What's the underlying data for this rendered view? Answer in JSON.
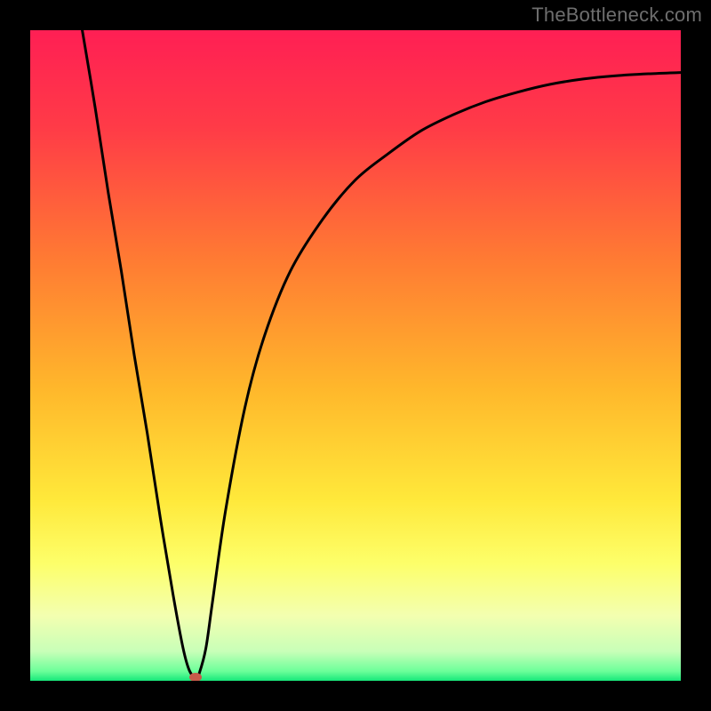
{
  "watermark": "TheBottleneck.com",
  "chart_data": {
    "type": "line",
    "title": "",
    "xlabel": "",
    "ylabel": "",
    "xlim": [
      0,
      100
    ],
    "ylim": [
      0,
      100
    ],
    "grid": false,
    "gradient_stops": [
      {
        "offset": 0.0,
        "color": "#ff1f54"
      },
      {
        "offset": 0.15,
        "color": "#ff3b47"
      },
      {
        "offset": 0.35,
        "color": "#ff7a33"
      },
      {
        "offset": 0.55,
        "color": "#ffb72b"
      },
      {
        "offset": 0.72,
        "color": "#ffe83a"
      },
      {
        "offset": 0.82,
        "color": "#fdff6a"
      },
      {
        "offset": 0.9,
        "color": "#f3ffb0"
      },
      {
        "offset": 0.955,
        "color": "#c8ffb8"
      },
      {
        "offset": 0.985,
        "color": "#6dff9a"
      },
      {
        "offset": 1.0,
        "color": "#17e87a"
      }
    ],
    "series": [
      {
        "name": "curve",
        "x": [
          8.0,
          10,
          12,
          14,
          16,
          18,
          20,
          22,
          23.5,
          24.5,
          25.5,
          26,
          27,
          28,
          30,
          33,
          36,
          40,
          45,
          50,
          55,
          60,
          65,
          70,
          75,
          80,
          85,
          90,
          95,
          100
        ],
        "y": [
          100,
          88,
          75,
          63,
          50,
          38,
          25,
          13,
          5,
          1.5,
          0.5,
          1.2,
          5,
          12,
          26,
          42,
          53,
          63,
          71,
          77,
          81,
          84.5,
          87,
          89,
          90.5,
          91.7,
          92.5,
          93,
          93.3,
          93.5
        ]
      }
    ],
    "marker": {
      "x": 25.4,
      "y": 0.5,
      "color": "#c85a4a"
    }
  }
}
